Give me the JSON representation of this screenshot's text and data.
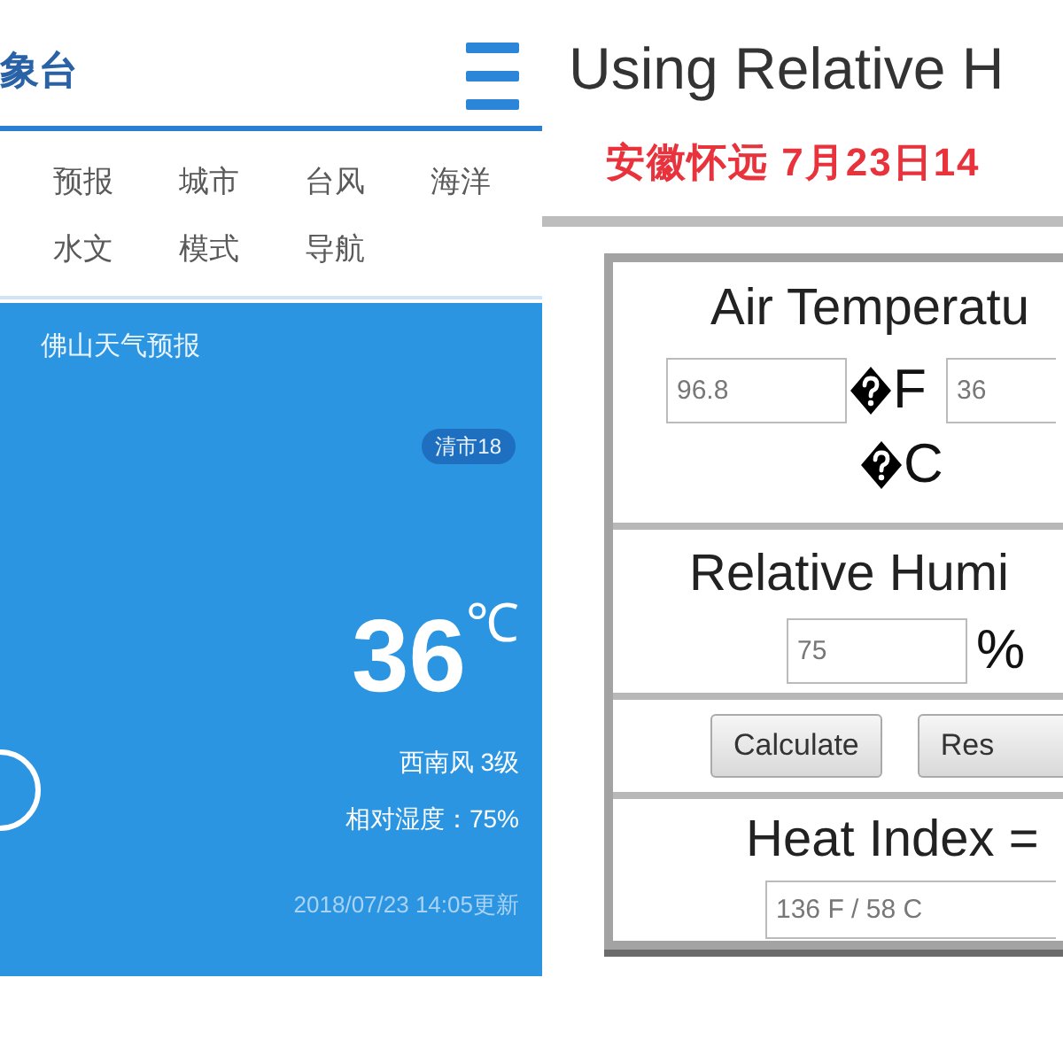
{
  "weather_site": {
    "logo": "象台",
    "nav_rows": [
      [
        "预报",
        "城市",
        "台风",
        "海洋"
      ],
      [
        "水文",
        "模式",
        "导航"
      ]
    ],
    "card": {
      "title": "佛山天气预报",
      "badge": "清市18",
      "temperature": "36",
      "unit": "℃",
      "wind": "西南风 3级",
      "humidity": "相对湿度：75%",
      "updated": "2018/07/23 14:05更新"
    }
  },
  "calculator_page": {
    "title": "Using Relative H",
    "subtitle": "安徽怀远 7月23日14",
    "sections": [
      {
        "kind": "inputs",
        "heading": "Air Temperatu",
        "fields": [
          {
            "value": "96.8",
            "garbled_sign": true,
            "unit": "F"
          },
          {
            "value": "36",
            "garbled_sign": true,
            "unit": "C"
          }
        ]
      },
      {
        "kind": "inputs",
        "heading": "Relative Humi",
        "fields": [
          {
            "value": "75",
            "unit": "%"
          }
        ]
      },
      {
        "kind": "buttons",
        "buttons": [
          "Calculate",
          "Res"
        ]
      },
      {
        "kind": "inputs",
        "heading": "Heat Index =",
        "fields": [
          {
            "value": "136 F / 58 C"
          }
        ]
      }
    ]
  }
}
